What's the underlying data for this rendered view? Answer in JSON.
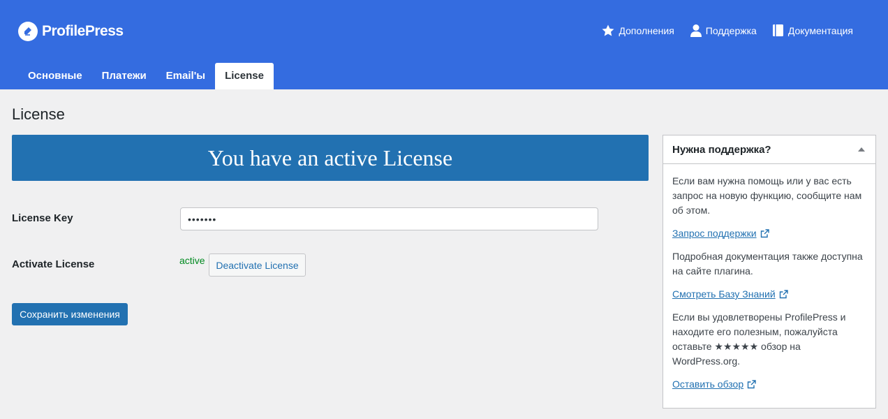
{
  "app": {
    "brand": "ProfilePress"
  },
  "header_links": [
    {
      "label": "Дополнения",
      "icon": "star-icon"
    },
    {
      "label": "Поддержка",
      "icon": "user-icon"
    },
    {
      "label": "Документация",
      "icon": "book-icon"
    }
  ],
  "tabs": [
    {
      "label": "Основные"
    },
    {
      "label": "Платежи"
    },
    {
      "label": "Email'ы"
    },
    {
      "label": "License",
      "active": true
    }
  ],
  "page": {
    "title": "License",
    "banner": "You have an active License"
  },
  "form": {
    "license_key_label": "License Key",
    "license_key_value": "•••••••",
    "activate_label": "Activate License",
    "status": "active",
    "deactivate_button": "Deactivate License",
    "save_button": "Сохранить изменения"
  },
  "sidebar": {
    "title": "Нужна поддержка?",
    "p1": "Если вам нужна помощь или у вас есть запрос на новую функцию, сообщите нам об этом.",
    "link1": "Запрос поддержки",
    "p2": "Подробная документация также доступна на сайте плагина.",
    "link2": "Смотреть Базу Знаний",
    "p3": "Если вы удовлетворены ProfilePress и находите его полезным, пожалуйста оставьте ★★★★★ обзор на WordPress.org.",
    "link3": "Оставить обзор"
  },
  "colors": {
    "header_bg": "#346ce0",
    "accent": "#2271b1",
    "status_green": "#008a20",
    "page_bg": "#f0f0f1"
  }
}
